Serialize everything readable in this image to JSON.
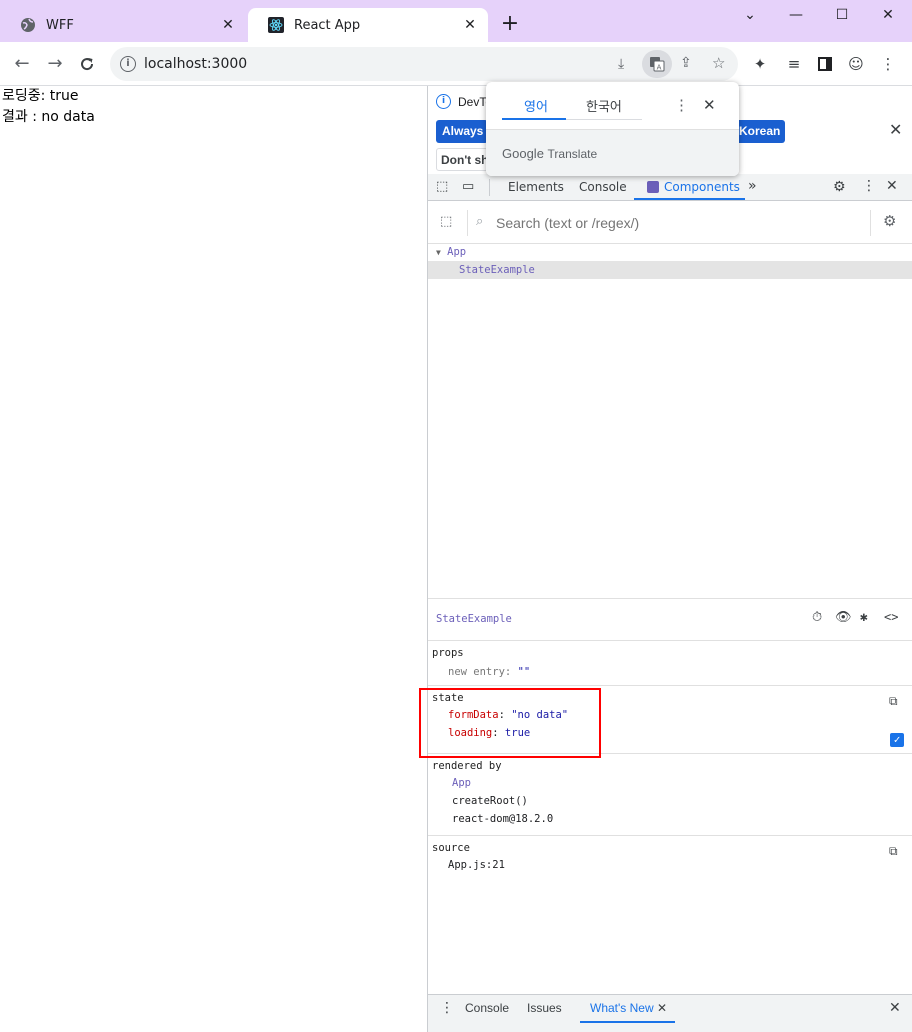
{
  "browser": {
    "tabs": [
      {
        "title": "WFF",
        "icon": "globe-icon"
      },
      {
        "title": "React App",
        "icon": "react-icon"
      }
    ],
    "url": "localhost:3000",
    "window_controls": {
      "dropdown": "⌄",
      "minimize": "—",
      "maximize": "☐",
      "close": "✕"
    }
  },
  "page": {
    "line1": "로딩중: true",
    "line2": "결과 : no data"
  },
  "translate_popup": {
    "lang_source": "영어",
    "lang_target": "한국어",
    "brand": "Google",
    "service": "Translate"
  },
  "devtools_notice": {
    "text_prefix": "DevTo",
    "always_button": "Always r",
    "korean_button": "Korean",
    "dont_button": "Don't sh"
  },
  "devtools": {
    "tabs": {
      "elements": "Elements",
      "console": "Console",
      "components": "Components"
    },
    "search_placeholder": "Search (text or /regex/)",
    "tree": {
      "root": "App",
      "child": "StateExample"
    },
    "selected_component": "StateExample",
    "props": {
      "title": "props",
      "items": [
        {
          "key": "new entry",
          "value": "\"\""
        }
      ]
    },
    "state": {
      "title": "state",
      "items": [
        {
          "key": "formData",
          "value": "\"no data\""
        },
        {
          "key": "loading",
          "value": "true"
        }
      ]
    },
    "rendered_by": {
      "title": "rendered by",
      "items": [
        "App",
        "createRoot()",
        "react-dom@18.2.0"
      ]
    },
    "source": {
      "title": "source",
      "value": "App.js:21"
    },
    "drawer": {
      "console": "Console",
      "issues": "Issues",
      "whats_new": "What's New"
    }
  },
  "colors": {
    "titlebar": "#e6d2fa",
    "active_tab_blue": "#1a73e8",
    "highlight_red": "#ff0000",
    "key_red": "#c80000",
    "value_blue": "#1a1aa6"
  }
}
